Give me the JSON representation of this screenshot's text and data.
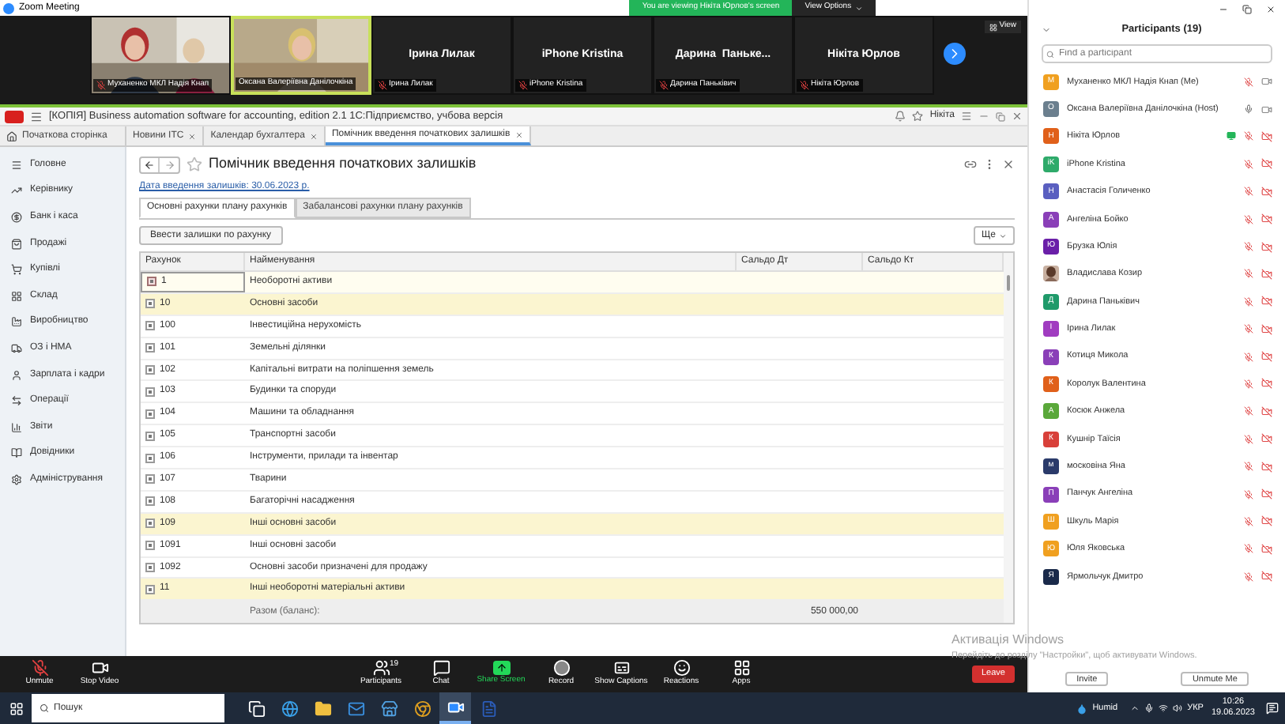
{
  "zoom_window": {
    "title": "Zoom Meeting",
    "banner": "You are viewing Нікіта Юрлов's screen",
    "view_options": "View Options"
  },
  "video_strip": {
    "view_button": "View",
    "tiles": [
      {
        "label": "Муханенко МКЛ Надія Кнап",
        "speaking": false,
        "muted": true
      },
      {
        "label": "Оксана Валеріївна Данілочкіна",
        "speaking": true,
        "muted": false
      },
      {
        "kind": "name",
        "name": "Ірина Лилак",
        "label": "Ірина Лилак",
        "speaking": false,
        "muted": true
      },
      {
        "kind": "name",
        "name": "iPhone Kristina",
        "label": "iPhone Kristina",
        "speaking": false,
        "muted": true
      },
      {
        "kind": "name",
        "name": "Дарина  Паньке...",
        "label": "Дарина Паньківич",
        "speaking": false,
        "muted": true
      },
      {
        "kind": "name",
        "name": "Нікіта Юрлов",
        "label": "Нікіта Юрлов",
        "speaking": false,
        "muted": true
      }
    ]
  },
  "app_1c": {
    "title": "[КОПІЯ] Business automation software for accounting, edition 2.1 1С:Підприємство, учбова версія",
    "user": "Нікіта",
    "tabs": [
      {
        "kind": "home",
        "label": "Початкова сторінка",
        "selected": false
      },
      {
        "kind": "closable",
        "label": "Новини ІТС",
        "selected": false
      },
      {
        "kind": "closable",
        "label": "Календар бухгалтера",
        "selected": false
      },
      {
        "kind": "closable",
        "label": "Помічник введення початкових залишків",
        "selected": true
      }
    ],
    "sidebar": [
      {
        "kind": "menu",
        "label": "Головне"
      },
      {
        "kind": "trend",
        "label": "Керівнику"
      },
      {
        "kind": "coin",
        "label": "Банк і каса"
      },
      {
        "kind": "bag",
        "label": "Продажі"
      },
      {
        "kind": "cart",
        "label": "Купівлі"
      },
      {
        "kind": "grid",
        "label": "Склад"
      },
      {
        "kind": "factory",
        "label": "Виробництво"
      },
      {
        "kind": "truck",
        "label": "ОЗ і НМА"
      },
      {
        "kind": "person",
        "label": "Зарплата і кадри"
      },
      {
        "kind": "transfer",
        "label": "Операції"
      },
      {
        "kind": "chart",
        "label": "Звіти"
      },
      {
        "kind": "book",
        "label": "Довідники"
      },
      {
        "kind": "gear",
        "label": "Адміністрування"
      }
    ],
    "page": {
      "title": "Помічник введення початкових залишків",
      "date_link": "Дата введення залишків: 30.06.2023 р.",
      "tabs": [
        {
          "label": "Основні рахунки плану рахунків",
          "selected": true
        },
        {
          "label": "Забалансові рахунки плану рахунків",
          "selected": false
        }
      ],
      "enter_button": "Ввести залишки по рахунку",
      "more_button": "Ще",
      "table": {
        "columns": [
          "Рахунок",
          "Найменування",
          "Сальдо Дт",
          "Сальдо Кт"
        ],
        "rows": [
          {
            "account": "1",
            "name": "Необоротні активи",
            "selected": true,
            "group": false
          },
          {
            "account": "10",
            "name": "Основні засоби",
            "selected": false,
            "group": true
          },
          {
            "account": "100",
            "name": "Інвестиційна нерухомість",
            "selected": false,
            "group": false
          },
          {
            "account": "101",
            "name": "Земельні ділянки",
            "selected": false,
            "group": false
          },
          {
            "account": "102",
            "name": "Капітальні витрати на поліпшення  земель",
            "selected": false,
            "group": false
          },
          {
            "account": "103",
            "name": "Будинки та споруди",
            "selected": false,
            "group": false
          },
          {
            "account": "104",
            "name": "Машини та обладнання",
            "selected": false,
            "group": false
          },
          {
            "account": "105",
            "name": "Транспортні засоби",
            "selected": false,
            "group": false
          },
          {
            "account": "106",
            "name": "Інструменти, прилади та інвентар",
            "selected": false,
            "group": false
          },
          {
            "account": "107",
            "name": "Тварини",
            "selected": false,
            "group": false
          },
          {
            "account": "108",
            "name": "Багаторічні насадження",
            "selected": false,
            "group": false
          },
          {
            "account": "109",
            "name": "Інші основні засоби",
            "selected": false,
            "group": true
          },
          {
            "account": "1091",
            "name": "Інші основні засоби",
            "selected": false,
            "group": false
          },
          {
            "account": "1092",
            "name": "Основні засоби призначені для продажу",
            "selected": false,
            "group": false
          },
          {
            "account": "11",
            "name": "Інші необоротні матеріальні активи",
            "selected": false,
            "group": true
          }
        ],
        "footer": {
          "label": "Разом (баланс):",
          "debit": "550 000,00"
        }
      }
    }
  },
  "zoom_toolbar": {
    "buttons": [
      {
        "kind": "mic",
        "label": "Unmute"
      },
      {
        "kind": "video",
        "label": "Stop Video"
      },
      {
        "kind": "participants",
        "label": "Participants",
        "badge": "19"
      },
      {
        "kind": "chat",
        "label": "Chat"
      },
      {
        "kind": "share",
        "label": "Share Screen"
      },
      {
        "kind": "record",
        "label": "Record"
      },
      {
        "kind": "captions",
        "label": "Show Captions"
      },
      {
        "kind": "reactions",
        "label": "Reactions"
      },
      {
        "kind": "apps",
        "label": "Apps"
      }
    ],
    "leave": "Leave"
  },
  "participants_panel": {
    "title": "Participants (19)",
    "search": {
      "placeholder": "Find a participant"
    },
    "participants": [
      {
        "kind": "initial",
        "initial": "М",
        "name": "Муханенко МКЛ Надія Кнап (Me)",
        "color": "#f0a020",
        "muted": true,
        "video_off": false,
        "sharing": false
      },
      {
        "kind": "initial",
        "initial": "О",
        "name": "Оксана Валеріївна Данілочкіна (Host)",
        "color": "#6b7f8e",
        "muted": false,
        "video_off": false,
        "sharing": false
      },
      {
        "kind": "initial",
        "initial": "Н",
        "name": "Нікіта Юрлов",
        "color": "#e0601a",
        "muted": true,
        "video_off": true,
        "sharing": true
      },
      {
        "kind": "initial",
        "initial": "iK",
        "name": "iPhone Kristina",
        "color": "#2eaa6a",
        "muted": true,
        "video_off": true,
        "sharing": false
      },
      {
        "kind": "initial",
        "initial": "Н",
        "name": "Анастасія Голиченко",
        "color": "#5a5fc0",
        "muted": true,
        "video_off": true,
        "sharing": false
      },
      {
        "kind": "initial",
        "initial": "А",
        "name": "Ангеліна Бойко",
        "color": "#8a3fb8",
        "muted": true,
        "video_off": true,
        "sharing": false
      },
      {
        "kind": "initial",
        "initial": "Ю",
        "name": "Брузка Юлія",
        "color": "#6a1fa8",
        "muted": true,
        "video_off": true,
        "sharing": false
      },
      {
        "name": "Владислава Козир",
        "muted": true,
        "video_off": true,
        "sharing": false
      },
      {
        "kind": "initial",
        "initial": "Д",
        "name": "Дарина Паньківич",
        "color": "#1f9a6a",
        "muted": true,
        "video_off": true,
        "sharing": false
      },
      {
        "kind": "initial",
        "initial": "І",
        "name": "Ірина Лилак",
        "color": "#a03cc0",
        "muted": true,
        "video_off": true,
        "sharing": false
      },
      {
        "kind": "initial",
        "initial": "К",
        "name": "Котиця Микола",
        "color": "#8a3fb8",
        "muted": true,
        "video_off": true,
        "sharing": false
      },
      {
        "kind": "initial",
        "initial": "К",
        "name": "Королук Валентина",
        "color": "#e0601a",
        "muted": true,
        "video_off": true,
        "sharing": false
      },
      {
        "kind": "initial",
        "initial": "А",
        "name": "Косюк Анжела",
        "color": "#5aa83a",
        "muted": true,
        "video_off": true,
        "sharing": false
      },
      {
        "kind": "initial",
        "initial": "К",
        "name": "Кушнір Таїсія",
        "color": "#d8403a",
        "muted": true,
        "video_off": true,
        "sharing": false
      },
      {
        "kind": "initial",
        "initial": "м",
        "name": "московіна Яна",
        "color": "#2a3a6a",
        "muted": true,
        "video_off": true,
        "sharing": false
      },
      {
        "kind": "initial",
        "initial": "П",
        "name": "Панчук Ангеліна",
        "color": "#8a3fb8",
        "muted": true,
        "video_off": true,
        "sharing": false
      },
      {
        "kind": "initial",
        "initial": "Ш",
        "name": "Шкуль Марія",
        "color": "#f0a020",
        "muted": true,
        "video_off": true,
        "sharing": false
      },
      {
        "kind": "initial",
        "initial": "Ю",
        "name": "Юля Яковська",
        "color": "#f0a020",
        "muted": true,
        "video_off": true,
        "sharing": false
      },
      {
        "kind": "initial",
        "initial": "Я",
        "name": "Ярмольчук Дмитро",
        "color": "#1a2a4a",
        "muted": true,
        "video_off": true,
        "sharing": false
      }
    ],
    "buttons": [
      "Invite",
      "Unmute Me"
    ]
  },
  "windows_activation": {
    "title": "Активація Windows",
    "text": "Перейдіть до розділу \"Настройки\", щоб активувати Windows."
  },
  "taskbar": {
    "search": {
      "placeholder": "Пошук"
    },
    "apps": [
      {
        "kind": "task-view",
        "selected": false
      },
      {
        "kind": "browser",
        "selected": false
      },
      {
        "kind": "folder",
        "selected": false
      },
      {
        "kind": "mail",
        "selected": false
      },
      {
        "kind": "store",
        "selected": false
      },
      {
        "kind": "chrome",
        "selected": false
      },
      {
        "kind": "video",
        "selected": true
      },
      {
        "kind": "word",
        "selected": false
      }
    ],
    "weather": "Humid",
    "language": "УКР",
    "time": "10:26",
    "date": "19.06.2023"
  }
}
